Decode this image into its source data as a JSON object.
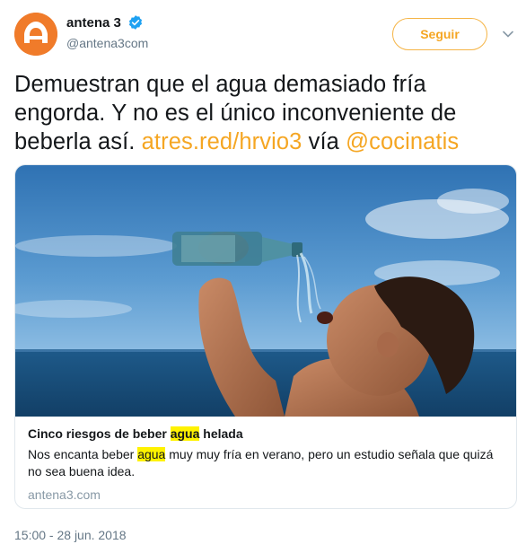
{
  "header": {
    "display_name": "antena 3",
    "handle": "@antena3com",
    "follow_label": "Seguir",
    "accent_color": "#f5a623",
    "avatar_color": "#f07b2a"
  },
  "tweet": {
    "text_part1": "Demuestran que el agua demasiado fría engorda. Y no es el único inconveniente de beberla así. ",
    "link1": "atres.red/hrvio3",
    "text_part2": " vía ",
    "mention": "@cocinatis"
  },
  "card": {
    "title_before": "Cinco riesgos de beber ",
    "title_highlight": "agua",
    "title_after": " helada",
    "desc_before": "Nos encanta beber ",
    "desc_highlight": "agua",
    "desc_after": " muy muy fría en verano, pero un estudio señala que quizá no sea buena idea.",
    "domain": "antena3.com"
  },
  "footer": {
    "timestamp": "15:00 - 28 jun. 2018"
  }
}
